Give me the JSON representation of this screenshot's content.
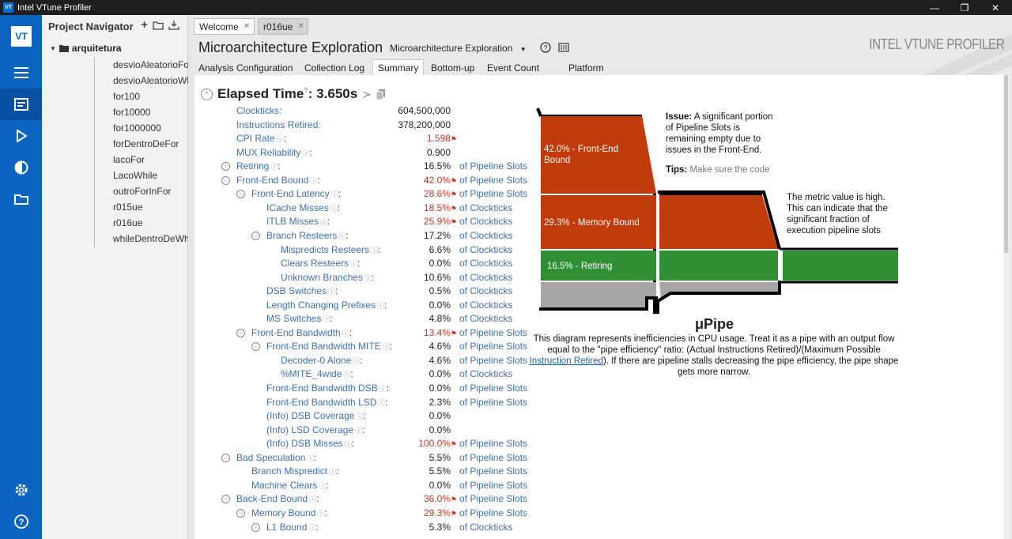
{
  "window": {
    "title": "Intel VTune Profiler",
    "logo": "VT"
  },
  "nav": {
    "header": "Project Navigator",
    "project": "arquitetura",
    "results": [
      "desvioAleatorioFor",
      "desvioAleatorioWhile",
      "for100",
      "for10000",
      "for1000000",
      "forDentroDeFor",
      "lacoFor",
      "LacoWhile",
      "outroForInFor",
      "r015ue",
      "r016ue",
      "whileDentroDeWhile"
    ]
  },
  "tabs": [
    {
      "label": "Welcome"
    },
    {
      "label": "r016ue"
    }
  ],
  "analysis": {
    "title": "Microarchitecture Exploration",
    "view": "Microarchitecture Exploration",
    "brand": "INTEL VTUNE PROFILER"
  },
  "subtabs": [
    "Analysis Configuration",
    "Collection Log",
    "Summary",
    "Bottom-up",
    "Event Count",
    "Platform"
  ],
  "elapsed": {
    "label": "Elapsed Time",
    "value": ": 3.650s"
  },
  "metrics": [
    {
      "label": "Clockticks:",
      "value": "604,500,000",
      "unit": "",
      "level": 0,
      "exp": false,
      "red": false
    },
    {
      "label": "Instructions Retired:",
      "value": "378,200,000",
      "unit": "",
      "level": 0,
      "exp": false,
      "red": false
    },
    {
      "label": "CPI Rate",
      "value": "1.598",
      "unit": "",
      "level": 0,
      "exp": false,
      "red": true
    },
    {
      "label": "MUX Reliability",
      "value": "0.900",
      "unit": "",
      "level": 0,
      "exp": false,
      "red": false
    },
    {
      "label": "Retiring",
      "value": "16.5%",
      "unit": "of Pipeline Slots",
      "level": 0,
      "exp": "closed",
      "red": false
    },
    {
      "label": "Front-End Bound",
      "value": "42.0%",
      "unit": "of Pipeline Slots",
      "level": 0,
      "exp": "open",
      "red": true
    },
    {
      "label": "Front-End Latency",
      "value": "28.6%",
      "unit": "of Pipeline Slots",
      "level": 1,
      "exp": "open",
      "red": true
    },
    {
      "label": "ICache Misses",
      "value": "18.5%",
      "unit": "of Clockticks",
      "level": 2,
      "exp": false,
      "red": true
    },
    {
      "label": "ITLB Misses",
      "value": "25.9%",
      "unit": "of Clockticks",
      "level": 2,
      "exp": false,
      "red": true
    },
    {
      "label": "Branch Resteers",
      "value": "17.2%",
      "unit": "of Clockticks",
      "level": 2,
      "exp": "open",
      "red": false
    },
    {
      "label": "Mispredicts Resteers",
      "value": "6.6%",
      "unit": "of Clockticks",
      "level": 3,
      "exp": false,
      "red": false
    },
    {
      "label": "Clears Resteers",
      "value": "0.0%",
      "unit": "of Clockticks",
      "level": 3,
      "exp": false,
      "red": false
    },
    {
      "label": "Unknown Branches",
      "value": "10.6%",
      "unit": "of Clockticks",
      "level": 3,
      "exp": false,
      "red": false
    },
    {
      "label": "DSB Switches",
      "value": "0.5%",
      "unit": "of Clockticks",
      "level": 2,
      "exp": false,
      "red": false
    },
    {
      "label": "Length Changing Prefixes",
      "value": "0.0%",
      "unit": "of Clockticks",
      "level": 2,
      "exp": false,
      "red": false
    },
    {
      "label": "MS Switches",
      "value": "4.8%",
      "unit": "of Clockticks",
      "level": 2,
      "exp": false,
      "red": false
    },
    {
      "label": "Front-End Bandwidth",
      "value": "13.4%",
      "unit": "of Pipeline Slots",
      "level": 1,
      "exp": "open",
      "red": true
    },
    {
      "label": "Front-End Bandwidth MITE",
      "value": "4.6%",
      "unit": "of Pipeline Slots",
      "level": 2,
      "exp": "open",
      "red": false
    },
    {
      "label": "Decoder-0 Alone",
      "value": "4.6%",
      "unit": "of Pipeline Slots",
      "level": 3,
      "exp": false,
      "red": false
    },
    {
      "label": "%MITE_4wide",
      "value": "0.0%",
      "unit": "of Clockticks",
      "level": 3,
      "exp": false,
      "red": false
    },
    {
      "label": "Front-End Bandwidth DSB",
      "value": "0.0%",
      "unit": "of Pipeline Slots",
      "level": 2,
      "exp": false,
      "red": false
    },
    {
      "label": "Front-End Bandwidth LSD",
      "value": "2.3%",
      "unit": "of Pipeline Slots",
      "level": 2,
      "exp": false,
      "red": false
    },
    {
      "label": "(Info) DSB Coverage",
      "value": "0.0%",
      "unit": "",
      "level": 2,
      "exp": false,
      "red": false
    },
    {
      "label": "(Info) LSD Coverage",
      "value": "0.0%",
      "unit": "",
      "level": 2,
      "exp": false,
      "red": false
    },
    {
      "label": "(Info) DSB Misses",
      "value": "100.0%",
      "unit": "of Pipeline Slots",
      "level": 2,
      "exp": false,
      "red": true
    },
    {
      "label": "Bad Speculation",
      "value": "5.5%",
      "unit": "of Pipeline Slots",
      "level": 0,
      "exp": "open",
      "red": false
    },
    {
      "label": "Branch Mispredict",
      "value": "5.5%",
      "unit": "of Pipeline Slots",
      "level": 1,
      "exp": false,
      "red": false
    },
    {
      "label": "Machine Clears",
      "value": "0.0%",
      "unit": "of Pipeline Slots",
      "level": 1,
      "exp": false,
      "red": false
    },
    {
      "label": "Back-End Bound",
      "value": "36.0%",
      "unit": "of Pipeline Slots",
      "level": 0,
      "exp": "open",
      "red": true
    },
    {
      "label": "Memory Bound",
      "value": "29.3%",
      "unit": "of Pipeline Slots",
      "level": 1,
      "exp": "open",
      "red": true
    },
    {
      "label": "L1 Bound",
      "value": "5.3%",
      "unit": "of Clockticks",
      "level": 2,
      "exp": "closed",
      "red": false
    }
  ],
  "pipe": {
    "frontend_label": "42.0% - Front-End Bound",
    "memory_label": "29.3% - Memory Bound",
    "retiring_label": "16.5% - Retiring",
    "issue_head": "Issue:",
    "issue_text": "A significant portion of Pipeline Slots is remaining empty due to issues in the Front-End.",
    "tips_head": "Tips:",
    "tips_text": "Make sure the code",
    "metric_note": "The metric value is high. This can indicate that the significant fraction of execution pipeline slots",
    "title": "μPipe",
    "desc_a": "This diagram represents inefficiencies in CPU usage. Treat it as a pipe with an output flow equal to the \"pipe efficiency\" ratio: (Actual Instructions Retired)/(Maximum Possible ",
    "desc_link": "Instruction Retired",
    "desc_b": "). If there are pipeline stalls decreasing the pipe efficiency, the pipe shape gets more narrow.",
    "colors": {
      "red": "#c23b0c",
      "green": "#2f8f35",
      "gray": "#a6a6a6"
    }
  }
}
